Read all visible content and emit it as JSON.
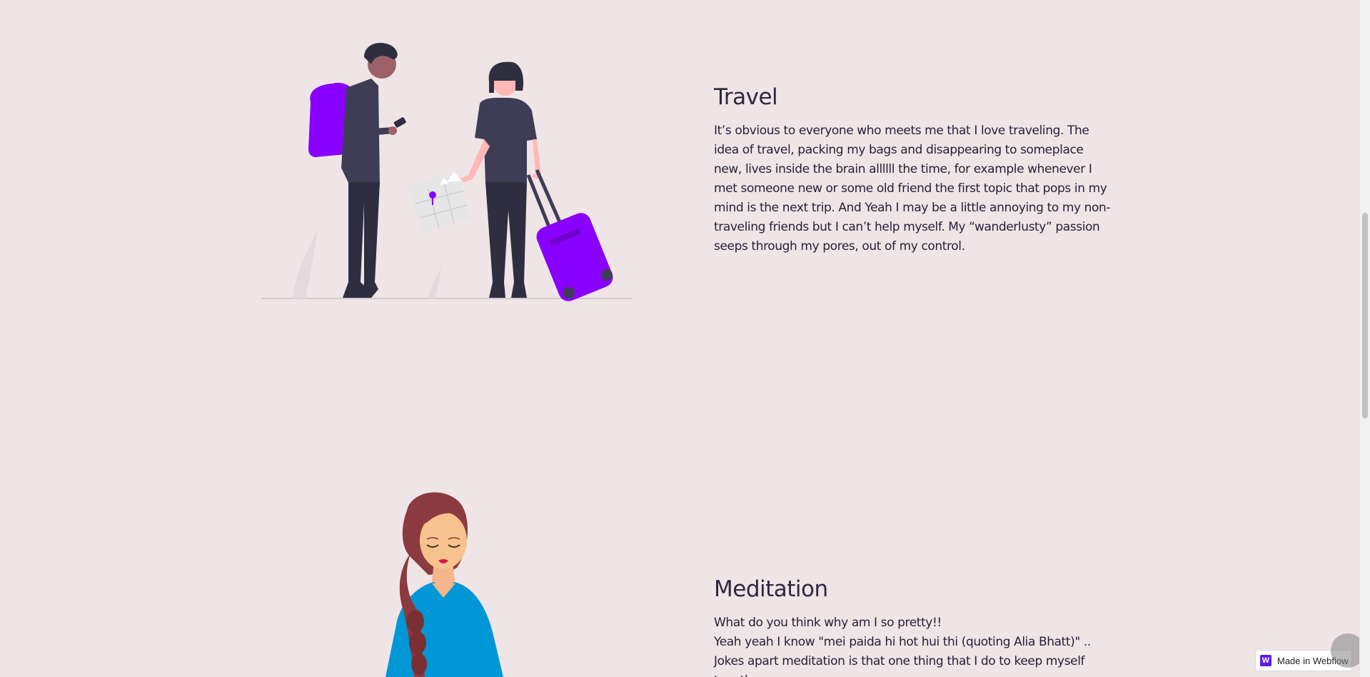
{
  "travel": {
    "title": "Travel",
    "body": "It’s obvious to everyone who meets me that I love traveling. The idea of travel, packing my bags and disappearing to someplace new, lives inside the brain allllll the time, for example whenever I met someone new or some old friend the first topic that pops in my mind is the next trip. And Yeah I may be a little annoying to my non-traveling friends but I can’t help myself. My “wanderlusty” passion seeps through my pores, out of my control.",
    "illustration": "travelers-illustration"
  },
  "meditation": {
    "title": "Meditation",
    "lines": [
      "What do you think why am I so pretty!!",
      "Yeah yeah I know \"mei paida hi hot hui thi (quoting Alia Bhatt)\" ..",
      "Jokes apart meditation is that one thing that I do to keep myself together.."
    ],
    "illustration": "meditating-woman-illustration"
  },
  "badge": {
    "logo_letter": "W",
    "label": "Made in Webflow"
  },
  "colors": {
    "background": "#f0e5e6",
    "accent": "#8a00ff",
    "text": "#2b2840"
  }
}
